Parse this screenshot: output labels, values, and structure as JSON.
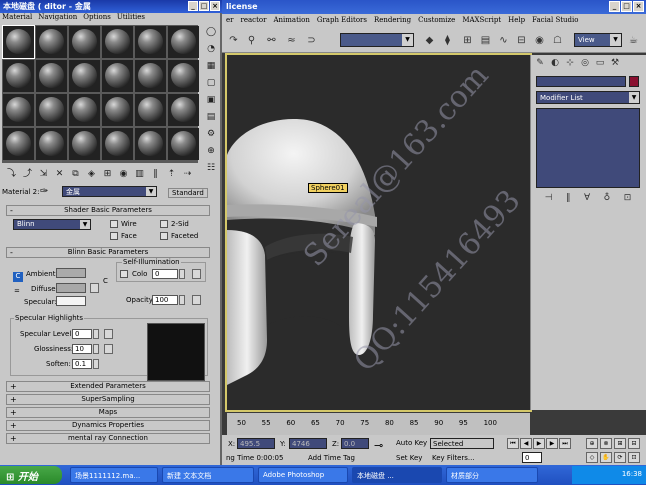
{
  "max": {
    "title_fragment": "license",
    "menu": [
      "er",
      "reactor",
      "Animation",
      "Graph Editors",
      "Rendering",
      "Customize",
      "MAXScript",
      "Help",
      "Facial Studio"
    ],
    "view_dropdown": "View",
    "object_label": "Sphere01",
    "modifier_list": "Modifier List",
    "watermarks": [
      "Sereal@163.com",
      "QQ:115416493"
    ]
  },
  "timeline": {
    "ticks": [
      "50",
      "55",
      "60",
      "65",
      "70",
      "75",
      "80",
      "85",
      "90",
      "95",
      "100"
    ]
  },
  "status": {
    "x_label": "X:",
    "x_value": "495.5",
    "y_label": "Y:",
    "y_value": "4746",
    "z_label": "Z:",
    "z_value": "0.0",
    "auto_key": "Auto Key",
    "selected": "Selected",
    "set_key": "Set Key",
    "key_filters": "Key Filters...",
    "time_text": "ng Time  0:00:05",
    "add_time_tag": "Add Time Tag",
    "frame_value": "0"
  },
  "material_editor": {
    "title": "本地磁盘 (  ditor - 金属",
    "menu": [
      "Material",
      "Navigation",
      "Options",
      "Utilities"
    ],
    "material_label": "Material 2:",
    "material_name": "金属",
    "material_type": "Standard",
    "shader_rollout": "Shader Basic Parameters",
    "shader_type": "Blinn",
    "wire": "Wire",
    "two_sided": "2-Sid",
    "face_map": "Face",
    "faceted": "Faceted",
    "blinn_rollout": "Blinn Basic Parameters",
    "self_illum": "Self-Illumination",
    "ambient": "Ambient:",
    "diffuse": "Diffuse:",
    "specular": "Specular:",
    "color_label": "Colo",
    "color_value": "0",
    "opacity_label": "Opacity:",
    "opacity_value": "100",
    "spec_highlights": "Specular Highlights",
    "spec_level_label": "Specular Level:",
    "spec_level_value": "0",
    "glossiness_label": "Glossiness:",
    "glossiness_value": "10",
    "soften_label": "Soften:",
    "soften_value": "0.1",
    "rollouts": [
      "Extended Parameters",
      "SuperSampling",
      "Maps",
      "Dynamics Properties",
      "mental ray Connection"
    ]
  },
  "taskbar": {
    "start": "开始",
    "tasks": [
      "场景1111112.ma...",
      "新建 文本文档",
      "Adobe Photoshop",
      "本地磁盘 ...",
      "材质部分"
    ],
    "clock": "16:38"
  }
}
